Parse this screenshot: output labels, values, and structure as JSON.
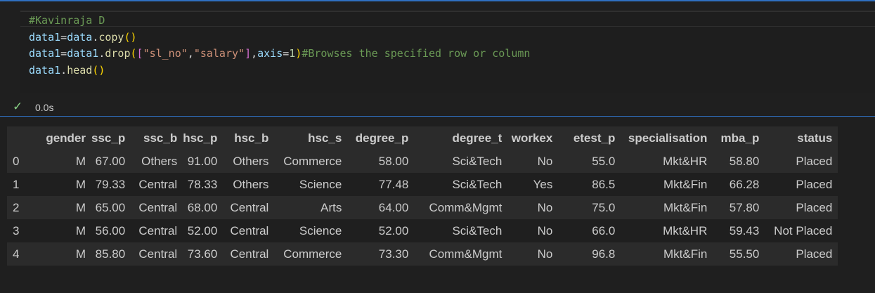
{
  "cell": {
    "code_lines": [
      [
        {
          "t": "#Kavinraja D",
          "c": "comment"
        }
      ],
      [
        {
          "t": "data1",
          "c": "var"
        },
        {
          "t": "=",
          "c": "op"
        },
        {
          "t": "data",
          "c": "var"
        },
        {
          "t": ".",
          "c": "op"
        },
        {
          "t": "copy",
          "c": "fn"
        },
        {
          "t": "()",
          "c": "p1"
        }
      ],
      [
        {
          "t": "data1",
          "c": "var"
        },
        {
          "t": "=",
          "c": "op"
        },
        {
          "t": "data1",
          "c": "var"
        },
        {
          "t": ".",
          "c": "op"
        },
        {
          "t": "drop",
          "c": "fn"
        },
        {
          "t": "(",
          "c": "p1"
        },
        {
          "t": "[",
          "c": "p2"
        },
        {
          "t": "\"sl_no\"",
          "c": "str"
        },
        {
          "t": ",",
          "c": "op"
        },
        {
          "t": "\"salary\"",
          "c": "str"
        },
        {
          "t": "]",
          "c": "p2"
        },
        {
          "t": ",",
          "c": "op"
        },
        {
          "t": "axis",
          "c": "var"
        },
        {
          "t": "=",
          "c": "op"
        },
        {
          "t": "1",
          "c": "num"
        },
        {
          "t": ")",
          "c": "p1"
        },
        {
          "t": "#Browses the specified row or column",
          "c": "comment"
        }
      ],
      [
        {
          "t": "data1",
          "c": "var"
        },
        {
          "t": ".",
          "c": "op"
        },
        {
          "t": "head",
          "c": "fn"
        },
        {
          "t": "()",
          "c": "p1"
        }
      ]
    ],
    "status": {
      "check": "✓",
      "exec_time": "0.0s"
    }
  },
  "output": {
    "columns": [
      "",
      "gender",
      "ssc_p",
      "ssc_b",
      "hsc_p",
      "hsc_b",
      "hsc_s",
      "degree_p",
      "degree_t",
      "workex",
      "etest_p",
      "specialisation",
      "mba_p",
      "status"
    ],
    "rows": [
      [
        "0",
        "M",
        "67.00",
        "Others",
        "91.00",
        "Others",
        "Commerce",
        "58.00",
        "Sci&Tech",
        "No",
        "55.0",
        "Mkt&HR",
        "58.80",
        "Placed"
      ],
      [
        "1",
        "M",
        "79.33",
        "Central",
        "78.33",
        "Others",
        "Science",
        "77.48",
        "Sci&Tech",
        "Yes",
        "86.5",
        "Mkt&Fin",
        "66.28",
        "Placed"
      ],
      [
        "2",
        "M",
        "65.00",
        "Central",
        "68.00",
        "Central",
        "Arts",
        "64.00",
        "Comm&Mgmt",
        "No",
        "75.0",
        "Mkt&Fin",
        "57.80",
        "Placed"
      ],
      [
        "3",
        "M",
        "56.00",
        "Central",
        "52.00",
        "Central",
        "Science",
        "52.00",
        "Sci&Tech",
        "No",
        "66.0",
        "Mkt&HR",
        "59.43",
        "Not Placed"
      ],
      [
        "4",
        "M",
        "85.80",
        "Central",
        "73.60",
        "Central",
        "Commerce",
        "73.30",
        "Comm&Mgmt",
        "No",
        "96.8",
        "Mkt&Fin",
        "55.50",
        "Placed"
      ]
    ]
  }
}
